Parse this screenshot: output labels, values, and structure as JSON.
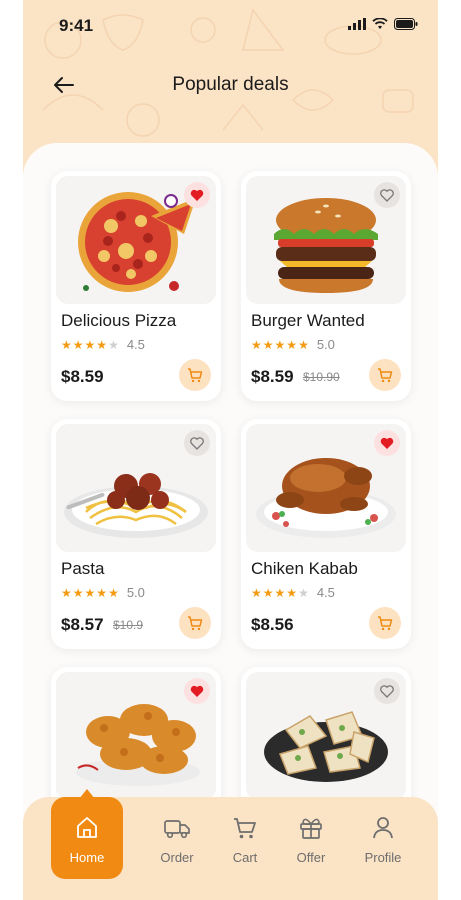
{
  "status": {
    "time": "9:41"
  },
  "header": {
    "title": "Popular deals"
  },
  "products": [
    {
      "name": "Delicious Pizza",
      "rating": 4,
      "score": "4.5",
      "price": "$8.59",
      "old_price": "",
      "favorite": true
    },
    {
      "name": "Burger Wanted",
      "rating": 5,
      "score": "5.0",
      "price": "$8.59",
      "old_price": "$10.90",
      "favorite": false
    },
    {
      "name": "Pasta",
      "rating": 5,
      "score": "5.0",
      "price": "$8.57",
      "old_price": "$10.9",
      "favorite": false
    },
    {
      "name": "Chiken Kabab",
      "rating": 4,
      "score": "4.5",
      "price": "$8.56",
      "old_price": "",
      "favorite": true
    },
    {
      "name": "",
      "favorite": true
    },
    {
      "name": "",
      "favorite": false
    }
  ],
  "nav": {
    "items": [
      {
        "label": "Home",
        "icon": "home-icon",
        "active": true
      },
      {
        "label": "Order",
        "icon": "truck-icon",
        "active": false
      },
      {
        "label": "Cart",
        "icon": "cart-icon",
        "active": false
      },
      {
        "label": "Offer",
        "icon": "gift-icon",
        "active": false
      },
      {
        "label": "Profile",
        "icon": "profile-icon",
        "active": false
      }
    ]
  },
  "colors": {
    "accent": "#f08a12",
    "header_bg": "#fbe3c6",
    "heart_active": "#e31b23",
    "star": "#f39c12"
  }
}
